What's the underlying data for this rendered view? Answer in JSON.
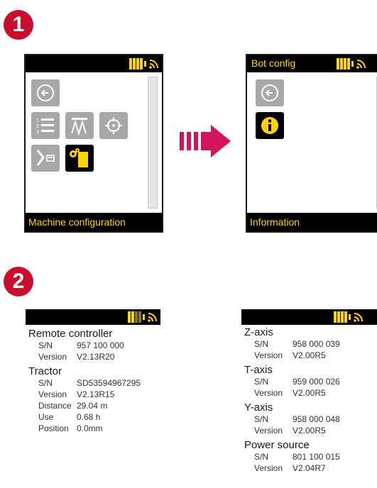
{
  "steps": [
    "1",
    "2"
  ],
  "screen1": {
    "title": "",
    "footer": "Machine configuration"
  },
  "screen2": {
    "title": "Bot config",
    "footer": "Information"
  },
  "panel1": {
    "sections": [
      {
        "name": "Remote controller",
        "rows": [
          [
            "S/N",
            "957 100 000"
          ],
          [
            "Version",
            "V2.13R20"
          ]
        ]
      },
      {
        "name": "Tractor",
        "rows": [
          [
            "S/N",
            "SD53594967295"
          ],
          [
            "Version",
            "V2.13R15"
          ],
          [
            "Distance",
            "29.04 m"
          ],
          [
            "Use",
            "0.68 h"
          ],
          [
            "Position",
            "0.0mm"
          ]
        ]
      }
    ]
  },
  "panel2": {
    "sections": [
      {
        "name": "Z-axis",
        "rows": [
          [
            "S/N",
            "958 000 039"
          ],
          [
            "Version",
            "V2.00R5"
          ]
        ]
      },
      {
        "name": "T-axis",
        "rows": [
          [
            "S/N",
            "959 000 026"
          ],
          [
            "Version",
            "V2.00R5"
          ]
        ]
      },
      {
        "name": "Y-axis",
        "rows": [
          [
            "S/N",
            "958 000 048"
          ],
          [
            "Version",
            "V2.00R5"
          ]
        ]
      },
      {
        "name": "Power source",
        "rows": [
          [
            "S/N",
            "801 100 015"
          ],
          [
            "Version",
            "V2.04R7"
          ]
        ]
      }
    ]
  },
  "icons": {
    "back": "back-arrow-icon",
    "list": "numbered-list-icon",
    "pattern": "zigzag-pattern-icon",
    "target": "crosshair-target-icon",
    "route": "route-path-icon",
    "config": "gear-machine-icon",
    "info": "info-icon",
    "battery": "battery-icon",
    "wifi": "wifi-signal-icon",
    "next": "next-step-arrow-icon"
  },
  "colors": {
    "accent": "#ffd400",
    "step": "#c8102e",
    "arrow": "#d4145a",
    "tile": "#a8a8a8"
  }
}
